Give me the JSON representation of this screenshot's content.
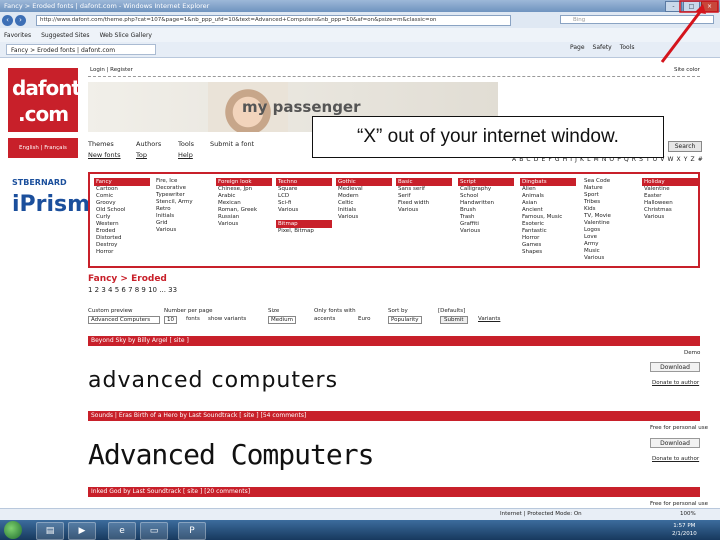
{
  "window": {
    "title": "Fancy > Eroded fonts | dafont.com - Windows Internet Explorer",
    "btn_min": "-",
    "btn_max": "□",
    "btn_close": "×"
  },
  "address": {
    "url": "http://www.dafont.com/theme.php?cat=107&page=1&nb_ppp_ufd=10&text=Advanced+Computers&nb_ppp=10&af=on&psize=m&classic=on",
    "search_placeholder": "Bing"
  },
  "favorites": {
    "label": "Favorites",
    "items": [
      "Suggested Sites",
      "Web Slice Gallery"
    ]
  },
  "tab": {
    "label": "Fancy > Eroded fonts | dafont.com"
  },
  "commands": [
    "Page",
    "Safety",
    "Tools"
  ],
  "site": {
    "logo_line1": "dafont",
    "logo_line2": ".com",
    "lang": "English | Français",
    "ad1": "STBERNARD",
    "ad2": "iPrism",
    "toplinks": "Login | Register",
    "stockleft": "Site color",
    "banner_text": "my passenger"
  },
  "callout": "“X” out of your internet window.",
  "menu": {
    "themes": "Themes",
    "authors": "Authors",
    "tools": "Tools",
    "submit": "Submit a font",
    "newfonts": "New fonts",
    "top": "Top",
    "help": "Help",
    "search": "Search"
  },
  "alphabet": "A B C D E F G H I J K L M N O P Q R S T U V W X Y Z #",
  "categories": [
    {
      "head": "Fancy",
      "items": [
        "Cartoon",
        "Comic",
        "Groovy",
        "Old School",
        "Curly",
        "Western",
        "Eroded",
        "Distorted",
        "Destroy",
        "Horror"
      ]
    },
    {
      "head": "",
      "items": [
        "Fire, Ice",
        "Decorative",
        "Typewriter",
        "Stencil, Army",
        "Retro",
        "Initials",
        "Grid",
        "Various"
      ]
    },
    {
      "head": "Foreign look",
      "items": [
        "Chinese, Jpn",
        "Arabic",
        "Mexican",
        "Roman, Greek",
        "Russian",
        "Various"
      ]
    },
    {
      "head": "Techno",
      "items": [
        "Square",
        "LCD",
        "Sci-fi",
        "Various"
      ]
    },
    {
      "head": "Gothic",
      "items": [
        "Medieval",
        "Modern",
        "Celtic",
        "Initials",
        "Various"
      ]
    },
    {
      "head": "Basic",
      "items": [
        "Sans serif",
        "Serif",
        "Fixed width",
        "Various"
      ]
    },
    {
      "head": "Script",
      "items": [
        "Calligraphy",
        "School",
        "Handwritten",
        "Brush",
        "Trash",
        "Graffiti",
        "Various"
      ]
    },
    {
      "head": "Dingbats",
      "items": [
        "Alien",
        "Animals",
        "Asian",
        "Ancient",
        "Famous, Music",
        "Esoteric",
        "Fantastic",
        "Horror",
        "Games",
        "Shapes"
      ]
    },
    {
      "head": "",
      "items": [
        "Sea Code",
        "Nature",
        "Sport",
        "Tribes",
        "Kids",
        "TV, Movie",
        "Valentine",
        "Logos",
        "Love",
        "Army",
        "Music",
        "Various"
      ]
    },
    {
      "head": "Holiday",
      "items": [
        "Valentine",
        "Easter",
        "Halloween",
        "Christmas",
        "Various"
      ]
    }
  ],
  "bitmap_head": "Bitmap",
  "bitmap_items": [
    "Pixel, Bitmap"
  ],
  "breadcrumb": "Fancy > Eroded",
  "pages": "1 2 3 4 5 6 7 8 9 10 ... 33",
  "options": {
    "custom_preview": "Custom preview",
    "preview_value": "Advanced Computers",
    "number_per_page": "Number per page",
    "npp_value": "10",
    "fonts": "fonts",
    "show_variants": "show variants",
    "size": "Size",
    "size_value": "Medium",
    "only_fonts_with": "Only fonts with",
    "accents": "accents",
    "euro": "Euro",
    "sort_by": "Sort by",
    "sort_value": "Popularity",
    "submit": "Submit",
    "reset": "[Defaults]",
    "variants_link": "Variants"
  },
  "fonts": [
    {
      "bar": "Beyond Sky by Billy Argel  [ site ]",
      "demo": "advanced computers",
      "note": "Demo",
      "download": "Download",
      "donate": "Donate to author",
      "free": ""
    },
    {
      "bar": "Sounds | Eras  Birth of a Hero by Last Soundtrack  [ site ]  [54 comments]",
      "demo": "Advanced Computers",
      "note": "Free for personal use",
      "download": "Download",
      "donate": "Donate to author",
      "free": ""
    },
    {
      "bar": "Inked God by Last Soundtrack  [ site ]  [20 comments]",
      "demo": "",
      "note": "Free for personal use",
      "download": "",
      "donate": "",
      "free": ""
    }
  ],
  "status": {
    "left": "Internet | Protected Mode: On",
    "zoom": "100%"
  },
  "taskbar": {
    "time": "1:57 PM",
    "date": "2/1/2010"
  }
}
